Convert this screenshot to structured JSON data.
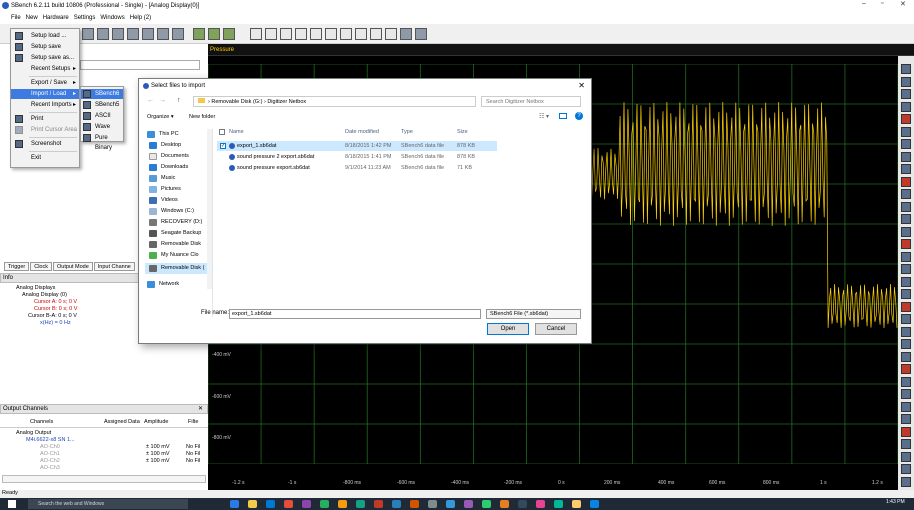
{
  "titlebar": {
    "title": "SBench 6.2.11 build 10806 (Professional - Single) - [Analog Display(0)]"
  },
  "menubar": [
    "File",
    "New",
    "Hardware",
    "Settings",
    "Windows",
    "Help (2)"
  ],
  "file_menu": {
    "items": [
      "Setup load ...",
      "Setup save",
      "Setup save as...",
      "Recent Setups",
      "Export / Save",
      "Import / Load",
      "Recent Imports",
      "Print",
      "Print Cursor Area",
      "Screenshot",
      "Exit"
    ]
  },
  "import_submenu": {
    "items": [
      "SBench6",
      "SBench5",
      "ASCII",
      "Wave",
      "Pure Binary"
    ]
  },
  "dialog": {
    "title": "Select files to import",
    "path": [
      "Removable Disk (G:)",
      "Digitizer Netbox"
    ],
    "search_placeholder": "Search Digitizer Netbox",
    "organize": "Organize",
    "new_folder": "New folder",
    "nav_items": [
      "This PC",
      "Desktop",
      "Documents",
      "Downloads",
      "Music",
      "Pictures",
      "Videos",
      "Windows (C:)",
      "RECOVERY (D:)",
      "Seagate Backup",
      "Removable Disk",
      "My Nuance Clo",
      "Removable Disk (",
      "Network"
    ],
    "columns": [
      "Name",
      "Date modified",
      "Type",
      "Size"
    ],
    "files": [
      {
        "name": "export_1.sb6dat",
        "date": "8/18/2015 1:42 PM",
        "type": "SBench6 data file",
        "size": "878 KB"
      },
      {
        "name": "sound pressure 2 export.sb6dat",
        "date": "8/18/2015 1:41 PM",
        "type": "SBench6 data file",
        "size": "878 KB"
      },
      {
        "name": "sound pressure export.sb6dat",
        "date": "9/1/2014 11:23 AM",
        "type": "SBench6 data file",
        "size": "71 KB"
      }
    ],
    "file_name_label": "File name:",
    "file_name_value": "export_1.sb6dat",
    "file_type": "SBench6 File (*.sb6dat)",
    "open_label": "Open",
    "cancel_label": "Cancel"
  },
  "left_panel": {
    "tabs": [
      "Trigger",
      "Clock",
      "Output Mode",
      "Input Channe"
    ],
    "info_title": "Info",
    "tree": [
      "Analog Displays",
      "Analog Display (0)",
      "Cursor A: 0 s; 0 V",
      "Cursor B: 0 s; 0 V",
      "Cursor B-A: 0 s; 0 V",
      "x(Hz) = 0 Hz"
    ],
    "output_title": "Output Channels",
    "output_columns": [
      "Channels",
      "Assigned Data",
      "Amplitude",
      "Filte"
    ],
    "output_tree": [
      "Analog Output",
      "M4i.6622-x8 SN 1...",
      "AO-Ch0",
      "AO-Ch1",
      "AO-Ch2",
      "AO-Ch3"
    ],
    "amplitudes": [
      "± 100 mV",
      "± 100 mV",
      "± 100 mV"
    ],
    "filters": [
      "No Fil",
      "No Fil",
      "No Fil"
    ]
  },
  "display": {
    "header": "Pressure",
    "y_labels": [
      "-400 mV",
      "-600 mV",
      "-800 mV"
    ],
    "x_labels": [
      "-1.2 s",
      "-1 s",
      "-800 ms",
      "-600 ms",
      "-400 ms",
      "-200 ms",
      "0 s",
      "200 ms",
      "400 ms",
      "600 ms",
      "800 ms",
      "1 s",
      "1.2 s"
    ],
    "trace_color": "#ffd200",
    "grid_color": "#1f6b1f"
  },
  "status": {
    "text": "Ready"
  },
  "taskbar": {
    "search": "Search the web and Windows",
    "time": "1:43 PM"
  }
}
